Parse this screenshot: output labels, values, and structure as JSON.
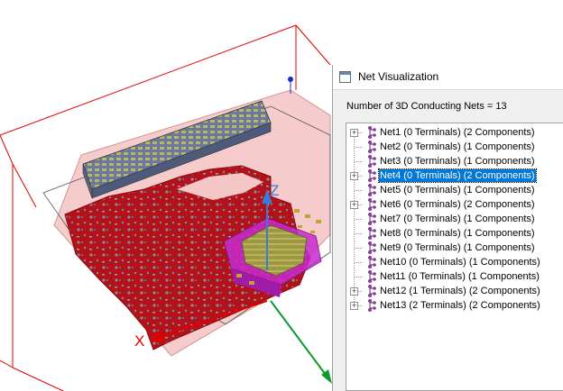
{
  "viewport": {
    "axis_z_label": "Z",
    "axis_x_label": "X",
    "colors": {
      "board_red": "#b0121a",
      "bounding_box": "#e00000",
      "pink_plane": "#f4c6c6",
      "magenta_component": "#c82ad0",
      "z_axis": "#3a7ad8",
      "y_axis": "#0a9a2a"
    }
  },
  "panel": {
    "title": "Net Visualization",
    "title_icon": "window-icon",
    "net_count_text": "Number of 3D Conducting Nets = 13",
    "net_icon": "net-tree-icon",
    "nets": [
      {
        "label": "Net1 (0 Terminals) (2 Components)",
        "expandable": true,
        "selected": false
      },
      {
        "label": "Net2 (0 Terminals) (1 Components)",
        "expandable": false,
        "selected": false
      },
      {
        "label": "Net3 (0 Terminals) (1 Components)",
        "expandable": false,
        "selected": false
      },
      {
        "label": "Net4 (0 Terminals) (2 Components)",
        "expandable": true,
        "selected": true
      },
      {
        "label": "Net5 (0 Terminals) (1 Components)",
        "expandable": false,
        "selected": false
      },
      {
        "label": "Net6 (0 Terminals) (2 Components)",
        "expandable": true,
        "selected": false
      },
      {
        "label": "Net7 (0 Terminals) (1 Components)",
        "expandable": false,
        "selected": false
      },
      {
        "label": "Net8 (0 Terminals) (1 Components)",
        "expandable": false,
        "selected": false
      },
      {
        "label": "Net9 (0 Terminals) (1 Components)",
        "expandable": false,
        "selected": false
      },
      {
        "label": "Net10 (0 Terminals) (1 Components)",
        "expandable": false,
        "selected": false
      },
      {
        "label": "Net11 (0 Terminals) (1 Components)",
        "expandable": false,
        "selected": false
      },
      {
        "label": "Net12 (1 Terminals) (2 Components)",
        "expandable": true,
        "selected": false
      },
      {
        "label": "Net13 (2 Terminals) (2 Components)",
        "expandable": true,
        "selected": false
      }
    ]
  }
}
